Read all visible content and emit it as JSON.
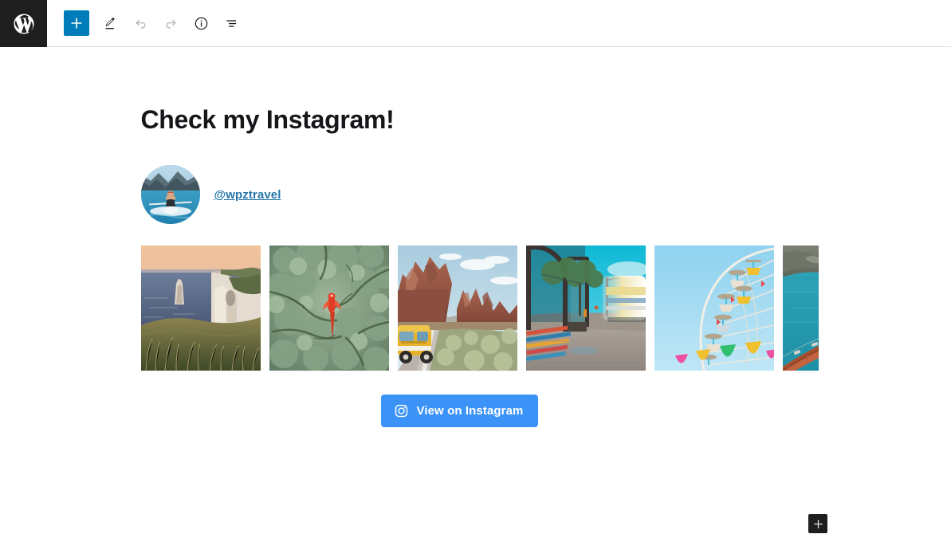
{
  "app": {
    "name": "WordPress Block Editor",
    "logo_icon": "wordpress-logo-icon"
  },
  "toolbar": {
    "add_block_label": "+",
    "add_block_icon": "plus-icon",
    "items": [
      {
        "name": "add-block",
        "icon": "plus-icon",
        "label": "Add block",
        "state": "primary"
      },
      {
        "name": "tools",
        "icon": "pencil-icon",
        "label": "Tools",
        "state": "active"
      },
      {
        "name": "undo",
        "icon": "undo-arrow-icon",
        "label": "Undo",
        "state": "disabled"
      },
      {
        "name": "redo",
        "icon": "redo-arrow-icon",
        "label": "Redo",
        "state": "disabled"
      },
      {
        "name": "details",
        "icon": "info-circle-icon",
        "label": "Details",
        "state": "active"
      },
      {
        "name": "list-view",
        "icon": "list-view-icon",
        "label": "List View",
        "state": "active"
      }
    ]
  },
  "content": {
    "heading": "Check my Instagram!",
    "instagram": {
      "avatar_alt": "paddleboarder-on-lake-avatar",
      "handle": "@wpztravel",
      "cta_label": "View on Instagram",
      "cta_icon": "instagram-camera-icon",
      "cta_color": "#3b93f7",
      "handle_color": "#2476a8",
      "photos": [
        {
          "alt": "coastal-cliffs-at-sunset",
          "name": "instagram-photo-1"
        },
        {
          "alt": "aerial-forest-canopy-with-red-macaw",
          "name": "instagram-photo-2"
        },
        {
          "alt": "yellow-van-on-desert-road",
          "name": "instagram-photo-3"
        },
        {
          "alt": "bus-stop-with-motion-blurred-bus",
          "name": "instagram-photo-4"
        },
        {
          "alt": "ferris-wheel-against-blue-sky",
          "name": "instagram-photo-5"
        },
        {
          "alt": "golden-gate-bridge-over-teal-water",
          "name": "instagram-photo-6"
        }
      ]
    }
  },
  "appender": {
    "label": "+",
    "icon": "plus-icon",
    "title": "Add block"
  },
  "colors": {
    "wp_blue": "#007cba",
    "header_bg": "#ffffff",
    "logo_bg": "#1e1e1e",
    "canvas_bg": "#ffffff",
    "text_dark": "#1e1e1e",
    "icon_disabled": "#b5b5b5"
  }
}
